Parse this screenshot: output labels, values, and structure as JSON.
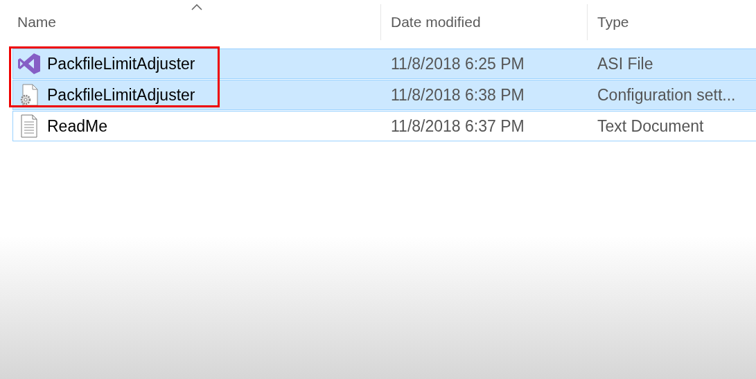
{
  "columns": [
    {
      "label": "Name",
      "sorted": true
    },
    {
      "label": "Date modified",
      "sorted": false
    },
    {
      "label": "Type",
      "sorted": false
    }
  ],
  "files": [
    {
      "kind": "studio",
      "name": "PackfileLimitAdjuster",
      "date": "11/8/2018 6:25 PM",
      "type": "ASI File",
      "selected": true,
      "focused": false,
      "annotated": true
    },
    {
      "kind": "config",
      "name": "PackfileLimitAdjuster",
      "date": "11/8/2018 6:38 PM",
      "type": "Configuration sett...",
      "selected": true,
      "focused": false,
      "annotated": true
    },
    {
      "kind": "text",
      "name": "ReadMe",
      "date": "11/8/2018 6:37 PM",
      "type": "Text Document",
      "selected": false,
      "focused": true,
      "annotated": false
    }
  ]
}
